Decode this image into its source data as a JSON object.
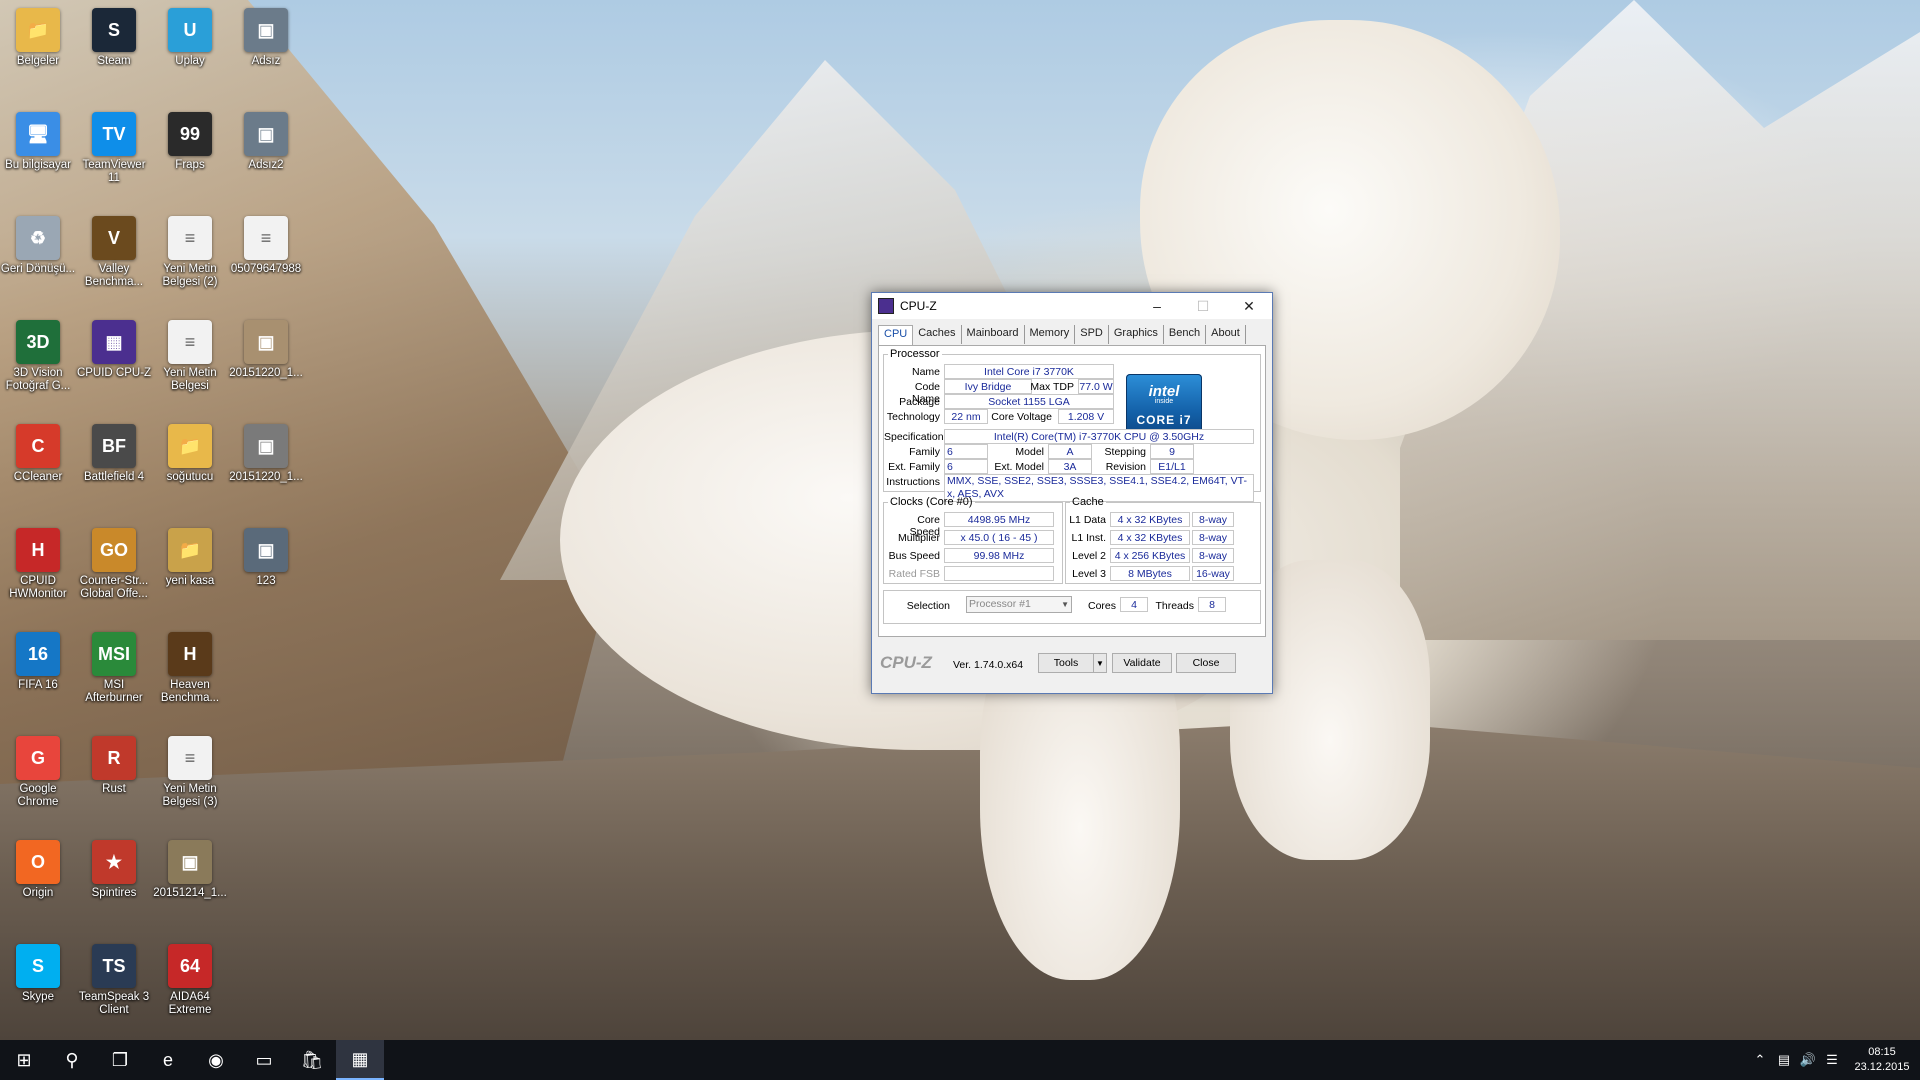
{
  "desktop": {
    "icons": [
      {
        "label": "Belgeler",
        "icon": "folder-icon",
        "color": "#e8b84a"
      },
      {
        "label": "Steam",
        "icon": "steam-icon",
        "color": "#1b2838"
      },
      {
        "label": "Uplay",
        "icon": "uplay-icon",
        "color": "#2a9fd8"
      },
      {
        "label": "Adsız",
        "icon": "image-file-icon",
        "color": "#6b7b8a"
      },
      {
        "label": "Bu bilgisayar",
        "icon": "computer-icon",
        "color": "#3a8ee6"
      },
      {
        "label": "TeamViewer 11",
        "icon": "teamviewer-icon",
        "color": "#0e8ee9"
      },
      {
        "label": "Fraps",
        "icon": "fraps-icon",
        "color": "#2a2a2a"
      },
      {
        "label": "Adsız2",
        "icon": "image-file-icon",
        "color": "#6b7b8a"
      },
      {
        "label": "Geri Dönüşü...",
        "icon": "recycle-bin-icon",
        "color": "#9aa7b4"
      },
      {
        "label": "Valley Benchma...",
        "icon": "valley-icon",
        "color": "#6b4a1e"
      },
      {
        "label": "Yeni Metin Belgesi (2)",
        "icon": "text-file-icon",
        "color": "#f2f2f2"
      },
      {
        "label": "05079647988",
        "icon": "text-file-icon",
        "color": "#f2f2f2"
      },
      {
        "label": "3D Vision Fotoğraf G...",
        "icon": "3d-vision-icon",
        "color": "#1f6f3a"
      },
      {
        "label": "CPUID CPU-Z",
        "icon": "cpuz-icon",
        "color": "#4b2f8f"
      },
      {
        "label": "Yeni Metin Belgesi",
        "icon": "text-file-icon",
        "color": "#f2f2f2"
      },
      {
        "label": "20151220_1...",
        "icon": "image-file-icon",
        "color": "#a89070"
      },
      {
        "label": "CCleaner",
        "icon": "ccleaner-icon",
        "color": "#d63a2a"
      },
      {
        "label": "Battlefield 4",
        "icon": "battlefield-icon",
        "color": "#4a4a4a"
      },
      {
        "label": "soğutucu",
        "icon": "folder-icon",
        "color": "#e8b84a"
      },
      {
        "label": "20151220_1...",
        "icon": "image-file-icon",
        "color": "#7a7a7a"
      },
      {
        "label": "CPUID HWMonitor",
        "icon": "hwmonitor-icon",
        "color": "#c62828"
      },
      {
        "label": "Counter-Str... Global Offe...",
        "icon": "csgo-icon",
        "color": "#c9892a"
      },
      {
        "label": "yeni kasa",
        "icon": "folder-icon",
        "color": "#c9a24a"
      },
      {
        "label": "123",
        "icon": "image-file-icon",
        "color": "#5a6a7a"
      },
      {
        "label": "FIFA 16",
        "icon": "fifa-icon",
        "color": "#1577c6"
      },
      {
        "label": "MSI Afterburner",
        "icon": "afterburner-icon",
        "color": "#2a8a3a"
      },
      {
        "label": "Heaven Benchma...",
        "icon": "heaven-icon",
        "color": "#5a3a1a"
      },
      {
        "label": "",
        "icon": "",
        "color": ""
      },
      {
        "label": "Google Chrome",
        "icon": "chrome-icon",
        "color": "#e8453c"
      },
      {
        "label": "Rust",
        "icon": "rust-icon",
        "color": "#c0392b"
      },
      {
        "label": "Yeni Metin Belgesi (3)",
        "icon": "text-file-icon",
        "color": "#f2f2f2"
      },
      {
        "label": "",
        "icon": "",
        "color": ""
      },
      {
        "label": "Origin",
        "icon": "origin-icon",
        "color": "#f26722"
      },
      {
        "label": "Spintires",
        "icon": "spintires-icon",
        "color": "#c0392b"
      },
      {
        "label": "20151214_1...",
        "icon": "image-file-icon",
        "color": "#8a7a5a"
      },
      {
        "label": "",
        "icon": "",
        "color": ""
      },
      {
        "label": "Skype",
        "icon": "skype-icon",
        "color": "#00aff0"
      },
      {
        "label": "TeamSpeak 3 Client",
        "icon": "teamspeak-icon",
        "color": "#2a3b54"
      },
      {
        "label": "AIDA64 Extreme",
        "icon": "aida64-icon",
        "color": "#c62828"
      }
    ],
    "icon_glyphs": [
      "📁",
      "S",
      "U",
      "▣",
      "🖥",
      "TV",
      "99",
      "▣",
      "♻",
      "V",
      "≡",
      "≡",
      "3D",
      "▦",
      "≡",
      "▣",
      "C",
      "BF",
      "📁",
      "▣",
      "H",
      "GO",
      "📁",
      "▣",
      "16",
      "MSI",
      "H",
      "",
      "G",
      "R",
      "≡",
      "",
      "O",
      "★",
      "▣",
      "",
      "S",
      "TS",
      "64"
    ]
  },
  "taskbar": {
    "buttons": [
      {
        "name": "start-button",
        "glyph": "⊞"
      },
      {
        "name": "search-button",
        "glyph": "⚲"
      },
      {
        "name": "task-view-button",
        "glyph": "❐"
      },
      {
        "name": "edge-button",
        "glyph": "e"
      },
      {
        "name": "chrome-button",
        "glyph": "◉"
      },
      {
        "name": "file-explorer-button",
        "glyph": "▭"
      },
      {
        "name": "store-button",
        "glyph": "🛍"
      },
      {
        "name": "cpuz-taskbar-button",
        "glyph": "▦"
      }
    ],
    "tray": {
      "time": "08:15",
      "date": "23.12.2015"
    }
  },
  "cpuz": {
    "title": "CPU-Z",
    "tabs": [
      "CPU",
      "Caches",
      "Mainboard",
      "Memory",
      "SPD",
      "Graphics",
      "Bench",
      "About"
    ],
    "selected_tab": "CPU",
    "processor": {
      "legend": "Processor",
      "name_label": "Name",
      "name": "Intel Core i7 3770K",
      "codename_label": "Code Name",
      "codename": "Ivy Bridge",
      "maxtdp_label": "Max TDP",
      "maxtdp": "77.0 W",
      "package_label": "Package",
      "package": "Socket 1155 LGA",
      "technology_label": "Technology",
      "technology": "22 nm",
      "corevoltage_label": "Core Voltage",
      "corevoltage": "1.208 V",
      "specification_label": "Specification",
      "specification": "Intel(R) Core(TM) i7-3770K CPU @ 3.50GHz",
      "family_label": "Family",
      "family": "6",
      "model_label": "Model",
      "model": "A",
      "stepping_label": "Stepping",
      "stepping": "9",
      "extfamily_label": "Ext. Family",
      "extfamily": "6",
      "extmodel_label": "Ext. Model",
      "extmodel": "3A",
      "revision_label": "Revision",
      "revision": "E1/L1",
      "instructions_label": "Instructions",
      "instructions": "MMX, SSE, SSE2, SSE3, SSSE3, SSE4.1, SSE4.2, EM64T, VT-x, AES, AVX",
      "logo_brand": "intel",
      "logo_inside": "inside",
      "logo_model": "CORE i7"
    },
    "clocks": {
      "legend": "Clocks (Core #0)",
      "corespeed_label": "Core Speed",
      "corespeed": "4498.95 MHz",
      "multiplier_label": "Multiplier",
      "multiplier": "x 45.0 ( 16 - 45 )",
      "busspeed_label": "Bus Speed",
      "busspeed": "99.98 MHz",
      "ratedfsb_label": "Rated FSB",
      "ratedfsb": ""
    },
    "cache": {
      "legend": "Cache",
      "rows": [
        {
          "label": "L1 Data",
          "size": "4 x 32 KBytes",
          "way": "8-way"
        },
        {
          "label": "L1 Inst.",
          "size": "4 x 32 KBytes",
          "way": "8-way"
        },
        {
          "label": "Level 2",
          "size": "4 x 256 KBytes",
          "way": "8-way"
        },
        {
          "label": "Level 3",
          "size": "8 MBytes",
          "way": "16-way"
        }
      ]
    },
    "selection": {
      "label": "Selection",
      "value": "Processor #1",
      "cores_label": "Cores",
      "cores": "4",
      "threads_label": "Threads",
      "threads": "8"
    },
    "footer": {
      "brand": "CPU-Z",
      "version": "Ver. 1.74.0.x64",
      "tools": "Tools",
      "validate": "Validate",
      "close": "Close"
    }
  }
}
